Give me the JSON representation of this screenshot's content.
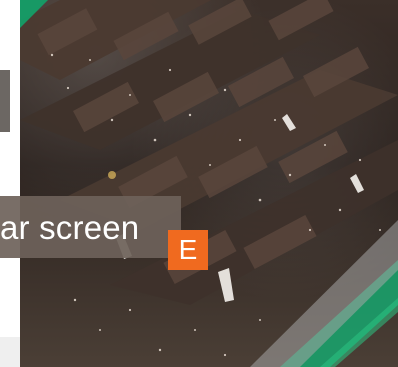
{
  "caption": {
    "text": "ar screen"
  },
  "badge": {
    "letter": "E",
    "color": "#f06a1f"
  }
}
